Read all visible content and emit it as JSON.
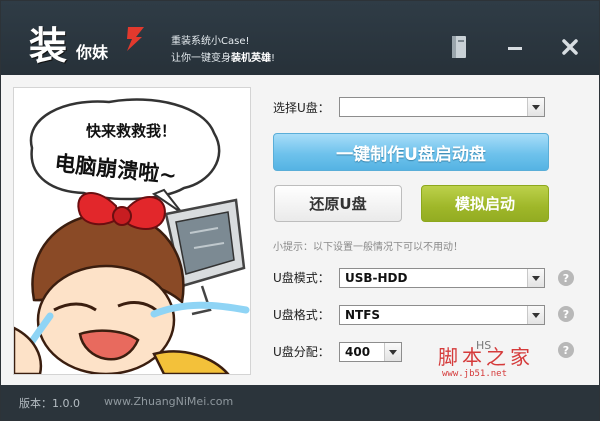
{
  "app": {
    "logo_big": "装",
    "logo_small": "你妹",
    "slogan_line1": "重装系统小Case!",
    "slogan_line2_prefix": "让你一键变身",
    "slogan_line2_bold": "装机英雄",
    "slogan_line2_suffix": "!"
  },
  "illustration": {
    "bubble_line1": "快来救救我！",
    "bubble_line2": "电脑崩溃啦~"
  },
  "form": {
    "select_drive_label": "选择U盘：",
    "select_drive_value": "",
    "primary_button": "一键制作U盘启动盘",
    "restore_button": "还原U盘",
    "simulate_button": "模拟启动",
    "tip": "小提示：以下设置一般情况下可以不用动！",
    "mode_label": "U盘模式：",
    "mode_value": "USB-HDD",
    "format_label": "U盘格式：",
    "format_value": "NTFS",
    "alloc_label": "U盘分配：",
    "alloc_value": "400",
    "partial_label": "HS"
  },
  "watermark": {
    "main": "脚本之家",
    "sub": "www.jb51.net"
  },
  "footer": {
    "version": "版本：1.0.0",
    "site": "www.ZhuangNiMei.com"
  },
  "colors": {
    "titlebar": "#2f3c46",
    "primary": "#6ec2ec",
    "simulate": "#9fb729",
    "footer": "#2b343b"
  },
  "icons": [
    "book-icon",
    "minimize-icon",
    "close-icon",
    "dropdown-arrow-icon",
    "help-icon"
  ]
}
